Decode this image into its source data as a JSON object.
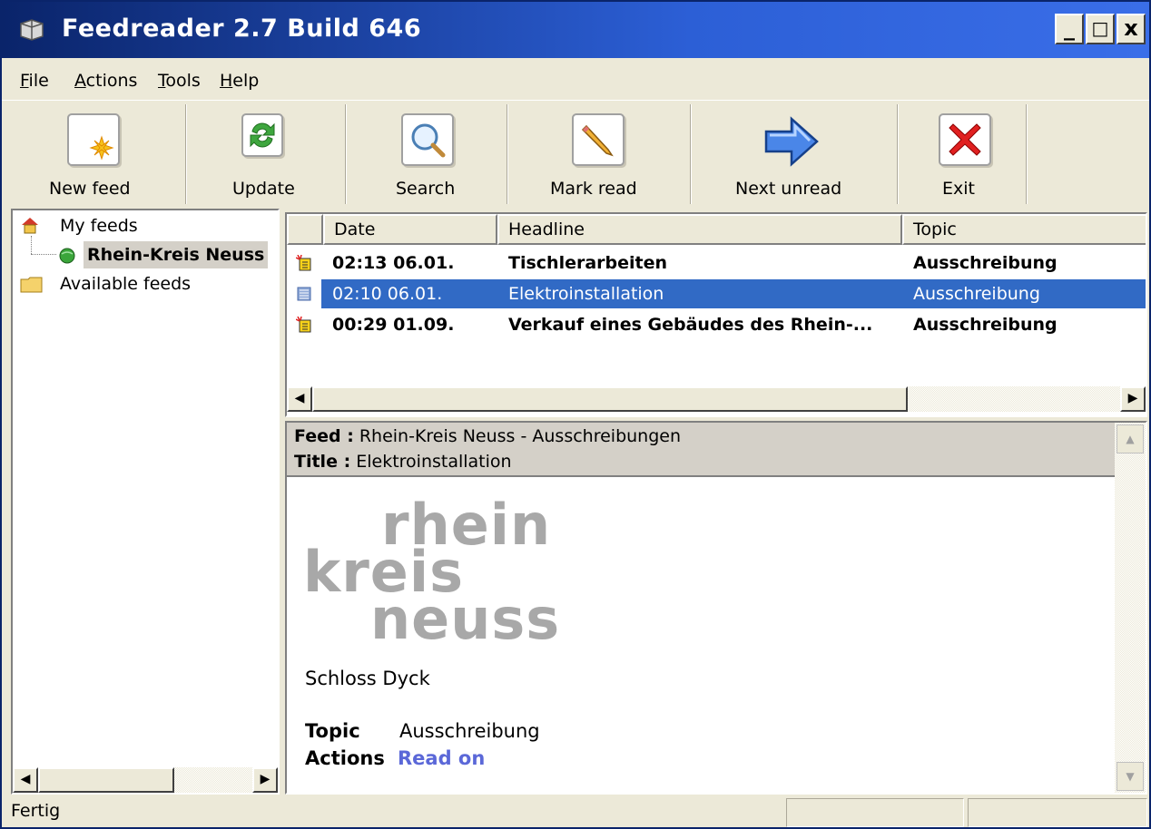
{
  "window": {
    "title": "Feedreader 2.7 Build 646",
    "controls": [
      "_",
      "□",
      "x"
    ]
  },
  "menu": [
    {
      "pre": "",
      "accel": "F",
      "post": "ile"
    },
    {
      "pre": "",
      "accel": "A",
      "post": "ctions"
    },
    {
      "pre": "",
      "accel": "T",
      "post": "ools"
    },
    {
      "pre": "",
      "accel": "H",
      "post": "elp"
    }
  ],
  "toolbar": {
    "new_feed": "New feed",
    "update": "Update",
    "search": "Search",
    "mark_read": "Mark read",
    "next_unread": "Next unread",
    "exit": "Exit"
  },
  "tree": {
    "root": "My feeds",
    "feed": "Rhein-Kreis Neuss",
    "available": "Available feeds"
  },
  "list": {
    "headers": {
      "date": "Date",
      "headline": "Headline",
      "topic": "Topic"
    },
    "rows": [
      {
        "date": "02:13 06.01.",
        "headline": "Tischlerarbeiten",
        "topic": "Ausschreibung"
      },
      {
        "date": "02:10 06.01.",
        "headline": "Elektroinstallation",
        "topic": "Ausschreibung"
      },
      {
        "date": "00:29 01.09.",
        "headline": "Verkauf eines Gebäudes des Rhein-...",
        "topic": "Ausschreibung"
      }
    ]
  },
  "preview": {
    "feed_label": "Feed :",
    "feed_value": "Rhein-Kreis Neuss - Ausschreibungen",
    "title_label": "Title :",
    "title_value": "Elektroinstallation",
    "logo_line1": "rhein",
    "logo_line2": "kreis",
    "logo_line3": "neuss",
    "body_text": "Schloss Dyck",
    "topic_label": "Topic",
    "topic_value": "Ausschreibung",
    "actions_label": "Actions",
    "actions_link": "Read on"
  },
  "status": {
    "text": "Fertig"
  },
  "colors": {
    "title_bar": "#2c5fd6",
    "selection": "#316ac5",
    "link": "#5b68d8"
  }
}
